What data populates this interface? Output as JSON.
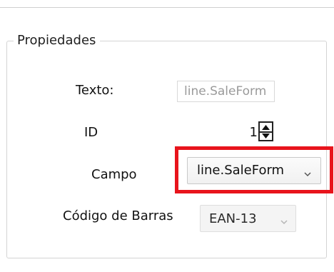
{
  "group": {
    "legend": "Propiedades"
  },
  "fields": {
    "texto": {
      "label": "Texto:",
      "value": "line.SaleForm"
    },
    "id": {
      "label": "ID",
      "value": "1"
    },
    "campo": {
      "label": "Campo",
      "selected": "line.SaleForm"
    },
    "codigo_barras": {
      "label": "Código de Barras",
      "selected": "EAN-13"
    }
  },
  "icons": {
    "stepper_up": "caret-up-icon",
    "stepper_down": "caret-down-icon",
    "dropdown": "chevron-down-icon"
  },
  "colors": {
    "highlight": "#e8141c",
    "disabled_text": "#9a9a9a"
  }
}
